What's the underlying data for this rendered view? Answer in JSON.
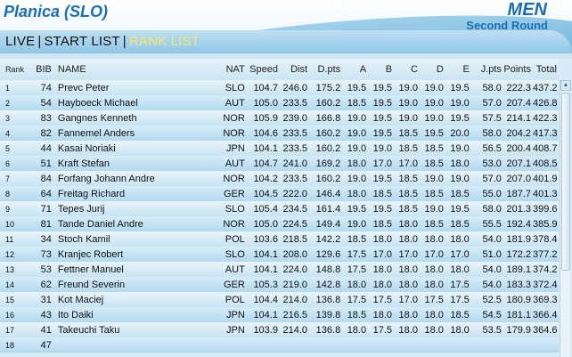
{
  "header": {
    "venue": "Planica (SLO)",
    "gender": "MEN",
    "round": "Second Round"
  },
  "tabs": [
    {
      "label": "LIVE",
      "active": false
    },
    {
      "label": "START LIST",
      "active": false
    },
    {
      "label": "RANK LIST",
      "active": true
    }
  ],
  "table": {
    "columns": [
      "Rank",
      "BIB",
      "NAME",
      "NAT",
      "Speed",
      "Dist",
      "D.pts",
      "A",
      "B",
      "C",
      "D",
      "E",
      "J.pts",
      "Points",
      "Total"
    ],
    "rows": [
      [
        "1",
        "74",
        "Prevc Peter",
        "SLO",
        "104.7",
        "246.0",
        "175.2",
        "19.5",
        "19.5",
        "19.0",
        "19.0",
        "19.5",
        "58.0",
        "222.3",
        "437.2"
      ],
      [
        "2",
        "54",
        "Hayboeck Michael",
        "AUT",
        "105.0",
        "233.5",
        "160.2",
        "18.5",
        "19.5",
        "19.0",
        "19.0",
        "19.0",
        "57.0",
        "207.4",
        "426.8"
      ],
      [
        "3",
        "83",
        "Gangnes Kenneth",
        "NOR",
        "105.9",
        "239.0",
        "166.8",
        "19.0",
        "19.5",
        "19.0",
        "19.0",
        "19.5",
        "57.5",
        "214.1",
        "422.3"
      ],
      [
        "4",
        "82",
        "Fannemel Anders",
        "NOR",
        "104.6",
        "233.5",
        "160.2",
        "19.0",
        "19.5",
        "18.5",
        "19.5",
        "20.0",
        "58.0",
        "204.2",
        "417.3"
      ],
      [
        "5",
        "44",
        "Kasai Noriaki",
        "JPN",
        "104.1",
        "233.5",
        "160.2",
        "19.0",
        "19.0",
        "18.5",
        "18.5",
        "19.0",
        "56.5",
        "200.4",
        "408.7"
      ],
      [
        "6",
        "51",
        "Kraft Stefan",
        "AUT",
        "104.7",
        "241.0",
        "169.2",
        "18.0",
        "17.0",
        "17.0",
        "18.5",
        "18.0",
        "53.0",
        "207.1",
        "408.5"
      ],
      [
        "7",
        "84",
        "Forfang Johann Andre",
        "NOR",
        "104.2",
        "233.5",
        "160.2",
        "19.0",
        "19.5",
        "18.5",
        "19.0",
        "19.0",
        "57.0",
        "207.0",
        "401.9"
      ],
      [
        "8",
        "64",
        "Freitag Richard",
        "GER",
        "104.5",
        "222.0",
        "146.4",
        "18.0",
        "18.5",
        "18.5",
        "18.5",
        "18.5",
        "55.0",
        "187.7",
        "401.3"
      ],
      [
        "9",
        "71",
        "Tepes Jurij",
        "SLO",
        "105.4",
        "234.5",
        "161.4",
        "19.5",
        "19.5",
        "18.5",
        "19.0",
        "19.5",
        "58.0",
        "201.3",
        "399.6"
      ],
      [
        "10",
        "81",
        "Tande Daniel Andre",
        "NOR",
        "105.0",
        "224.5",
        "149.4",
        "19.0",
        "18.5",
        "18.0",
        "18.5",
        "18.5",
        "55.5",
        "192.4",
        "385.9"
      ],
      [
        "11",
        "34",
        "Stoch Kamil",
        "POL",
        "103.6",
        "218.5",
        "142.2",
        "18.5",
        "18.0",
        "18.0",
        "18.0",
        "18.0",
        "54.0",
        "181.9",
        "378.4"
      ],
      [
        "12",
        "73",
        "Kranjec Robert",
        "SLO",
        "104.1",
        "208.0",
        "129.6",
        "17.5",
        "17.0",
        "17.0",
        "17.0",
        "17.0",
        "51.0",
        "172.2",
        "377.2"
      ],
      [
        "13",
        "53",
        "Fettner Manuel",
        "AUT",
        "104.1",
        "224.0",
        "148.8",
        "17.5",
        "18.0",
        "18.0",
        "18.0",
        "18.0",
        "54.0",
        "189.1",
        "374.2"
      ],
      [
        "14",
        "62",
        "Freund Severin",
        "GER",
        "105.3",
        "219.0",
        "142.8",
        "18.0",
        "18.0",
        "18.0",
        "18.0",
        "17.5",
        "54.0",
        "183.3",
        "372.4"
      ],
      [
        "15",
        "31",
        "Kot Maciej",
        "POL",
        "104.4",
        "214.0",
        "136.8",
        "17.5",
        "17.5",
        "17.0",
        "17.5",
        "17.5",
        "52.5",
        "180.9",
        "369.3"
      ],
      [
        "16",
        "43",
        "Ito Daiki",
        "JPN",
        "104.1",
        "216.5",
        "139.8",
        "18.5",
        "18.0",
        "18.0",
        "18.0",
        "18.5",
        "54.5",
        "181.1",
        "366.4"
      ],
      [
        "17",
        "41",
        "Takeuchi Taku",
        "JPN",
        "103.9",
        "214.0",
        "136.8",
        "18.0",
        "17.5",
        "18.0",
        "18.0",
        "18.0",
        "53.5",
        "179.9",
        "364.6"
      ],
      [
        "18",
        "47",
        "",
        "",
        "",
        "",
        "",
        "",
        "",
        "",
        "",
        "",
        "",
        "",
        ""
      ]
    ]
  }
}
